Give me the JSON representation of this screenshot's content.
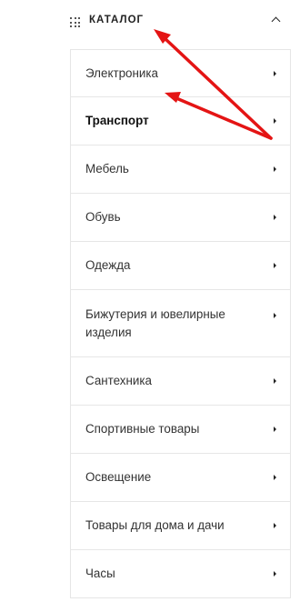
{
  "catalog": {
    "title": "КАТАЛОГ",
    "grid_icon": "grid-icon",
    "collapse_icon": "chevron-up-icon"
  },
  "menu": {
    "items": [
      {
        "label": "Электроника"
      },
      {
        "label": "Транспорт"
      },
      {
        "label": "Мебель"
      },
      {
        "label": "Обувь"
      },
      {
        "label": "Одежда"
      },
      {
        "label": "Бижутерия и ювелирные изделия"
      },
      {
        "label": "Сантехника"
      },
      {
        "label": "Спортивные товары"
      },
      {
        "label": "Освещение"
      },
      {
        "label": "Товары для дома и дачи"
      },
      {
        "label": "Часы"
      }
    ],
    "item_icon": "caret-right-icon"
  },
  "annotation": {
    "arrow_color": "#e41414"
  },
  "colors": {
    "border": "#e6e6e6",
    "text": "#333333",
    "accent": "#e41414"
  }
}
